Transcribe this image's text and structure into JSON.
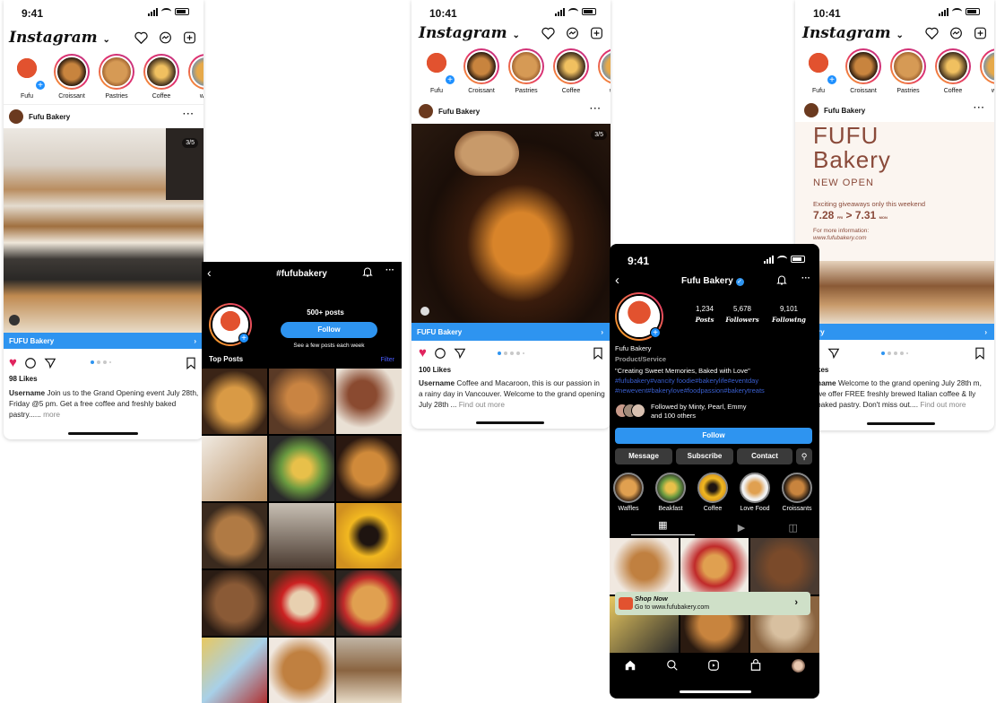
{
  "screen1": {
    "time": "9:41",
    "app_title": "Instagram",
    "stories": [
      {
        "name": "Fufu"
      },
      {
        "name": "Croissant"
      },
      {
        "name": "Pastries"
      },
      {
        "name": "Coffee"
      },
      {
        "name": "waffl"
      }
    ],
    "post_account": "Fufu Bakery",
    "counter": "3/5",
    "cta_label": "FUFU Bakery",
    "likes": "98 Likes",
    "caption_user": "Username",
    "caption_text": " Join us to the Grand Opening event July 28th, Friday @5 pm. Get a free coffee and freshly baked pastry......",
    "caption_more": " more"
  },
  "screen2": {
    "title": "#fufubakery",
    "posts_count": "500+ posts",
    "follow_label": "Follow",
    "subtext": "See a few posts each week",
    "section_title": "Top Posts",
    "filter_label": "Filter"
  },
  "screen3": {
    "time": "10:41",
    "app_title": "Instagram",
    "stories": [
      {
        "name": "Fufu"
      },
      {
        "name": "Croissant"
      },
      {
        "name": "Pastries"
      },
      {
        "name": "Coffee"
      },
      {
        "name": "waffl"
      }
    ],
    "post_account": "Fufu Bakery",
    "counter": "3/5",
    "cta_label": "FUFU Bakery",
    "likes": "100 Likes",
    "caption_user": "Username",
    "caption_text": " Coffee and Macaroon, this is our passion in a rainy day in Vancouver. Welcome to the grand opening July 28th ...",
    "caption_more": " Find out more"
  },
  "screen4": {
    "time": "9:41",
    "profile_name": "Fufu Bakery",
    "stats": [
      {
        "value": "1,234",
        "label": "Posts"
      },
      {
        "value": "5,678",
        "label": "Followers"
      },
      {
        "value": "9,101",
        "label": "Following"
      }
    ],
    "display_name": "Fufu Bakery",
    "category": "Product/Service",
    "bio": "\"Creating Sweet Memories, Baked with Love\"",
    "hashtags": "#fufubakery#vancity foodie#bakerylife#eventday #newevent#bakerylove#foodpassion#bakerytreats",
    "followed_by": "Followed by Minty, Pearl, Emmy",
    "followed_by_2": "and 100 others",
    "follow_label": "Follow",
    "message_label": "Message",
    "subscribe_label": "Subscribe",
    "contact_label": "Contact",
    "highlights": [
      {
        "name": "Waffles"
      },
      {
        "name": "Beakfast"
      },
      {
        "name": "Coffee"
      },
      {
        "name": "Love Food"
      },
      {
        "name": "Croissants"
      }
    ],
    "shop_title": "Shop Now",
    "shop_url": "Go to www.fufubakery.com"
  },
  "screen5": {
    "time": "10:41",
    "app_title": "Instagram",
    "stories": [
      {
        "name": "Fufu"
      },
      {
        "name": "Croissant"
      },
      {
        "name": "Pastries"
      },
      {
        "name": "Coffee"
      },
      {
        "name": "waffl"
      }
    ],
    "post_account": "Fufu Bakery",
    "poster_line1": "FUFU",
    "poster_line2": "Bakery",
    "poster_line3": "NEW OPEN",
    "poster_giveaway": "Exciting giveaways only this weekend",
    "poster_date_a": "7.28",
    "poster_date_a_sub": "FRI",
    "poster_arrow": ">",
    "poster_date_b": "7.31",
    "poster_date_b_sub": "MON",
    "poster_more": "For more information:",
    "poster_url": "www.fufubakery.com",
    "cta_label": "Bakery",
    "likes": "kes",
    "caption_user": "name",
    "caption_text": " Welcome to the grand opening July 28th m, we offer FREE freshly brewed Italian coffee & lly baked pastry. Don't miss out....",
    "caption_more": " Find out more"
  },
  "colors": {
    "accent": "#2e94f0",
    "heart": "#e0245e",
    "story_ring_start": "#f9a825",
    "story_ring_end": "#c13584"
  }
}
